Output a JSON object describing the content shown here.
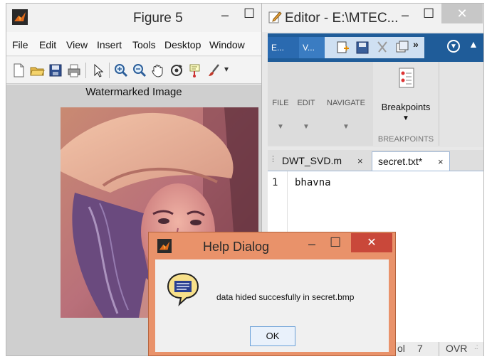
{
  "figure": {
    "title": "Figure 5",
    "menu": [
      "File",
      "Edit",
      "View",
      "Insert",
      "Tools",
      "Desktop",
      "Window"
    ],
    "toolbar_icons": [
      "new-file-icon",
      "open-folder-icon",
      "save-icon",
      "print-icon",
      "pointer-icon",
      "zoom-in-icon",
      "zoom-out-icon",
      "pan-hand-icon",
      "rotate-3d-icon",
      "data-cursor-icon",
      "brush-icon"
    ],
    "plot_title": "Watermarked Image"
  },
  "editor": {
    "title": "Editor - E:\\MTEC...",
    "tabs": [
      "E...",
      "V..."
    ],
    "ribbon": {
      "file": "FILE",
      "edit": "EDIT",
      "navigate": "NAVIGATE",
      "breakpoints_button": "Breakpoints",
      "breakpoints_group": "BREAKPOINTS"
    },
    "files": [
      {
        "name": "DWT_SVD.m",
        "close": "×"
      },
      {
        "name": "secret.txt*",
        "close": "×"
      }
    ],
    "lines": [
      {
        "num": "1",
        "text": "bhavna"
      }
    ],
    "status": {
      "col_label": "ol",
      "col_value": "7",
      "mode": "OVR"
    }
  },
  "dialog": {
    "title": "Help Dialog",
    "message": "data hided succesfully in secret.bmp",
    "ok_label": "OK"
  },
  "window_buttons": {
    "minimize": "–",
    "maximize": "☐",
    "close": "✕"
  },
  "colors": {
    "editor_accent": "#1f5c99",
    "dialog_frame": "#e9926a",
    "dialog_close": "#c9483a"
  }
}
